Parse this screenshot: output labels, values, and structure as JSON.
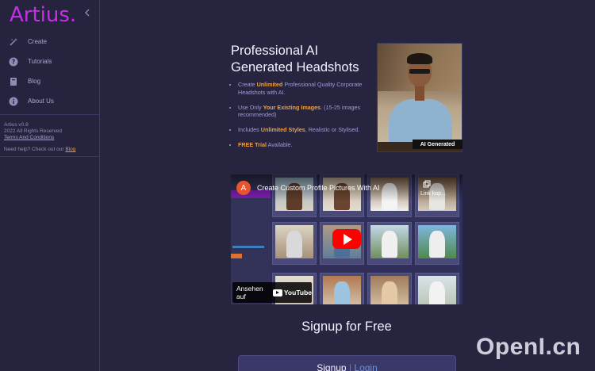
{
  "sidebar": {
    "brand": "Artius",
    "brand_dot": ".",
    "collapse_icon": "chevron-left-icon",
    "items": [
      {
        "label": "Create",
        "icon": "magic-wand-icon"
      },
      {
        "label": "Tutorials",
        "icon": "help-circle-icon"
      },
      {
        "label": "Blog",
        "icon": "book-icon"
      },
      {
        "label": "About Us",
        "icon": "info-icon"
      }
    ],
    "version": "Artius v0.8",
    "rights": "2022 All Rights Reserved",
    "terms": "Terms And Conditions",
    "help_prefix": "Need help? Check out our",
    "help_link": "Blog"
  },
  "hero": {
    "title": "Professional AI Generated Headshots",
    "bullets": [
      {
        "pre": "Create ",
        "hl": "Unlimited",
        "post": " Professional Quality Corporate Headshots with AI."
      },
      {
        "pre": "Use Only ",
        "hl": "Your Existing Images",
        "post": ". (15-25 images recommended)"
      },
      {
        "pre": "Includes ",
        "hl": "Unlimited Styles",
        "post": ", Realistic or Stylised."
      },
      {
        "pre": "",
        "hl": "FREE Trial",
        "post": " Available."
      }
    ],
    "badge": "AI Generated"
  },
  "video": {
    "channel_initial": "A",
    "title": "Create Custom Profile Pictures With AI",
    "copy_label": "Link kop...",
    "watch_on": "Ansehen auf",
    "yt_brand": "YouTube"
  },
  "signup": {
    "heading": "Signup for Free",
    "signup_label": "Signup",
    "separator": "|",
    "login_label": "Login"
  },
  "watermark": "OpenI.cn",
  "colors": {
    "background": "#26243f",
    "brand": "#c62fe8",
    "highlight": "#f0a040",
    "bullet_text": "#9f9cd8"
  }
}
